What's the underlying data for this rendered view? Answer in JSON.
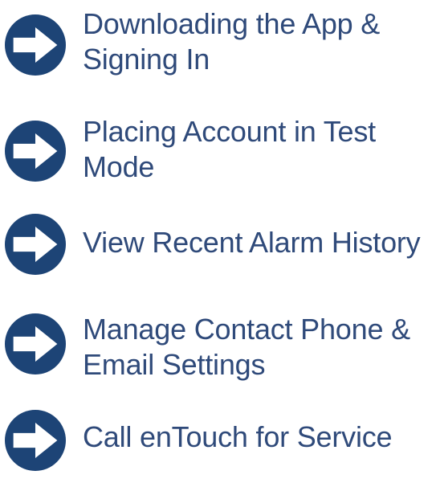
{
  "accent_color": "#1d4476",
  "menu": {
    "items": [
      {
        "icon": "arrow-right-circle-icon",
        "line1": "Downloading the App &",
        "line2": "Signing In"
      },
      {
        "icon": "arrow-right-circle-icon",
        "line1": "Placing Account in Test",
        "line2": "Mode"
      },
      {
        "icon": "arrow-right-circle-icon",
        "line1": "View Recent Alarm History",
        "line2": ""
      },
      {
        "icon": "arrow-right-circle-icon",
        "line1": "Manage Contact Phone &",
        "line2": "Email Settings"
      },
      {
        "icon": "arrow-right-circle-icon",
        "line1": "Call enTouch for Service",
        "line2": ""
      }
    ]
  }
}
